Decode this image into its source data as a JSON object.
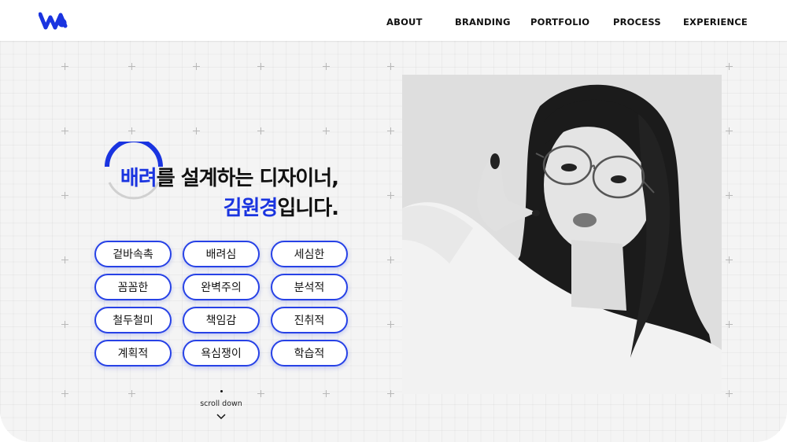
{
  "header": {
    "nav": [
      "ABOUT",
      "BRANDING",
      "PORTFOLIO",
      "PROCESS",
      "EXPERIENCE"
    ]
  },
  "hero": {
    "line1_highlight": "배려",
    "line1_rest": "를 설계하는 디자이너,",
    "line2_highlight": "김원경",
    "line2_rest": "입니다."
  },
  "tags": [
    "겉바속촉",
    "배려심",
    "세심한",
    "꼼꼼한",
    "완벽주의",
    "분석적",
    "철두철미",
    "책임감",
    "진취적",
    "계획적",
    "욕심쟁이",
    "학습적"
  ],
  "scroll": {
    "label": "scroll down"
  },
  "colors": {
    "accent": "#1a34e0",
    "grid_bg": "#f4f4f4"
  },
  "icons": {
    "logo": "w-logo-icon",
    "scroll": "chevron-down-icon"
  }
}
